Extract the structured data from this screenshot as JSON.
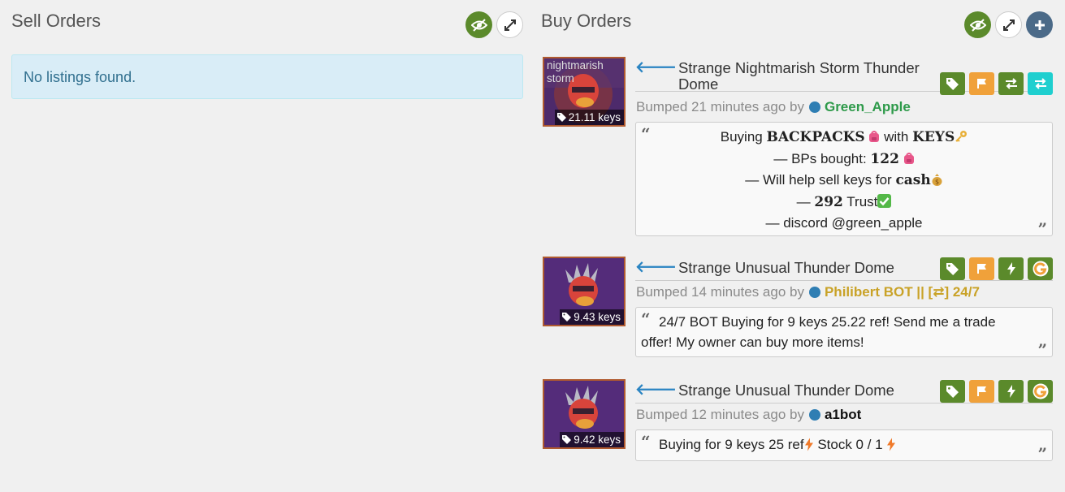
{
  "sell": {
    "title": "Sell Orders",
    "empty_message": "No listings found."
  },
  "buy": {
    "title": "Buy Orders",
    "listings": [
      {
        "effect": "nightmarish storm",
        "price": "21.11 keys",
        "title": "Strange Nightmarish Storm Thunder Dome",
        "bumped": "Bumped 21 minutes ago by",
        "user": "Green_Apple",
        "comment": {
          "l1a": "Buying ",
          "l1b": "BACKPACKS",
          "l1c": " with ",
          "l1d": "KEYS",
          "l2a": "— BPs bought: ",
          "l2b": "122",
          "l3a": "— Will help sell keys for ",
          "l3b": "cash",
          "l4a": "— ",
          "l4b": "292",
          "l4c": " Trust",
          "l5": "— discord @green_apple"
        }
      },
      {
        "effect": "",
        "price": "9.43 keys",
        "title": "Strange Unusual Thunder Dome",
        "bumped": "Bumped 14 minutes ago by",
        "user": "Philibert BOT || [⇄] 24/7",
        "comment": "24/7 BOT Buying for 9 keys 25.22 ref! Send me a trade offer! My owner can buy more items!"
      },
      {
        "effect": "",
        "price": "9.42 keys",
        "title": "Strange Unusual Thunder Dome",
        "bumped": "Bumped 12 minutes ago by",
        "user": "a1bot",
        "comment_a": "Buying for 9 keys 25 ref ",
        "comment_b": " Stock 0 / 1 "
      }
    ]
  },
  "icons": {
    "header": [
      "eye-slash-icon",
      "expand-icon",
      "plus-icon"
    ],
    "listing_buttons": [
      "tag-icon",
      "flag-icon",
      "exchange-icon",
      "lightning-icon",
      "g-logo-icon"
    ]
  },
  "colors": {
    "green": "#5b8a2b",
    "orange": "#f0a13a",
    "teal": "#1fcfcf",
    "info_bg": "#d9edf7",
    "info_text": "#31708f",
    "user_green": "#2e9a4a",
    "user_gold": "#c9a227"
  }
}
